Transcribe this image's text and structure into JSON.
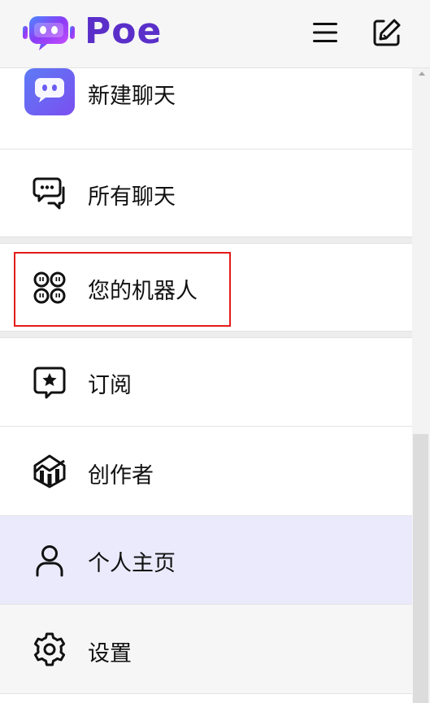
{
  "header": {
    "app_name": "Poe",
    "logo_icon": "poe-bot-logo-icon",
    "menu_button": "hamburger-menu-icon",
    "compose_button": "new-chat-edit-icon"
  },
  "menu": {
    "items": [
      {
        "label": "新建聊天",
        "icon": "poe-bot-avatar-icon"
      },
      {
        "label": "所有聊天",
        "icon": "chat-bubbles-icon"
      },
      {
        "label": "您的机器人",
        "icon": "bots-grid-icon"
      },
      {
        "label": "订阅",
        "icon": "star-bubble-icon"
      },
      {
        "label": "创作者",
        "icon": "creator-chart-icon"
      },
      {
        "label": "个人主页",
        "icon": "person-icon"
      },
      {
        "label": "设置",
        "icon": "gear-icon"
      }
    ]
  },
  "colors": {
    "brand": "#5a2fc9",
    "active_bg": "#ebeafd",
    "highlight_border": "#e41b1b"
  }
}
